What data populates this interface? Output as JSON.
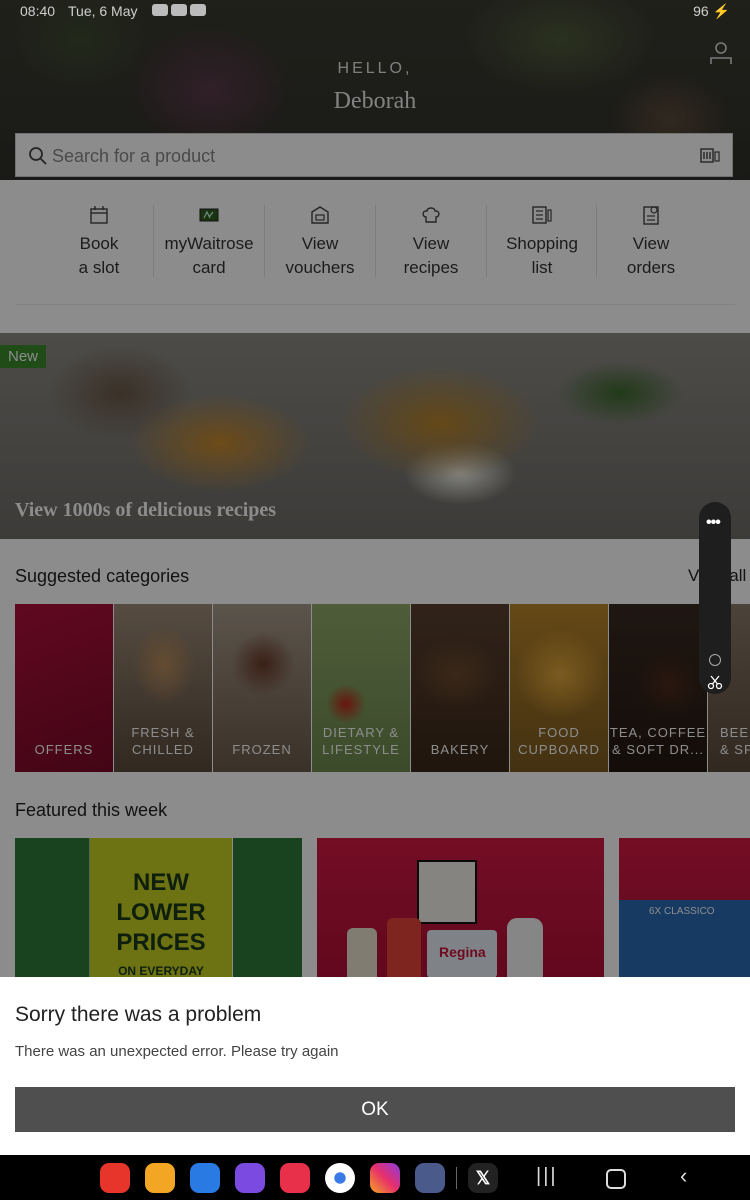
{
  "status_bar": {
    "time": "08:40",
    "date": "Tue, 6 May",
    "battery": "96"
  },
  "header": {
    "greeting": "HELLO,",
    "name": "Deborah"
  },
  "search": {
    "placeholder": "Search for a product"
  },
  "quick_actions": [
    {
      "label_line1": "Book",
      "label_line2": "a slot",
      "icon": "calendar-icon"
    },
    {
      "label_line1": "myWaitrose",
      "label_line2": "card",
      "icon": "loyalty-card-icon"
    },
    {
      "label_line1": "View",
      "label_line2": "vouchers",
      "icon": "voucher-icon"
    },
    {
      "label_line1": "View",
      "label_line2": "recipes",
      "icon": "chef-hat-icon"
    },
    {
      "label_line1": "Shopping",
      "label_line2": "list",
      "icon": "list-icon"
    },
    {
      "label_line1": "View",
      "label_line2": "orders",
      "icon": "orders-icon"
    }
  ],
  "banner": {
    "badge": "New",
    "cta": "View 1000s of delicious recipes"
  },
  "suggested": {
    "title": "Suggested categories",
    "view_all": "View all",
    "categories": [
      {
        "line1": "OFFERS",
        "line2": ""
      },
      {
        "line1": "FRESH &",
        "line2": "CHILLED"
      },
      {
        "line1": "FROZEN",
        "line2": ""
      },
      {
        "line1": "DIETARY &",
        "line2": "LIFESTYLE"
      },
      {
        "line1": "BAKERY",
        "line2": ""
      },
      {
        "line1": "FOOD",
        "line2": "CUPBOARD"
      },
      {
        "line1": "TEA, COFFEE",
        "line2": "& SOFT DR..."
      },
      {
        "line1": "BEER",
        "line2": "& SP"
      }
    ]
  },
  "featured": {
    "title": "Featured this week",
    "card1_lines": [
      "NEW",
      "LOWER",
      "PRICES",
      "ON EVERYDAY"
    ],
    "card2_brand": "Regina",
    "card3_label": "6X CLASSICO"
  },
  "dialog": {
    "title": "Sorry there was a problem",
    "message": "There was an unexpected error. Please try again",
    "ok_label": "OK"
  },
  "colors": {
    "accent_green": "#3a8a2a",
    "ok_button": "#4f4f4f",
    "featured_yellow": "#c7d021",
    "featured_red": "#c8123a"
  }
}
